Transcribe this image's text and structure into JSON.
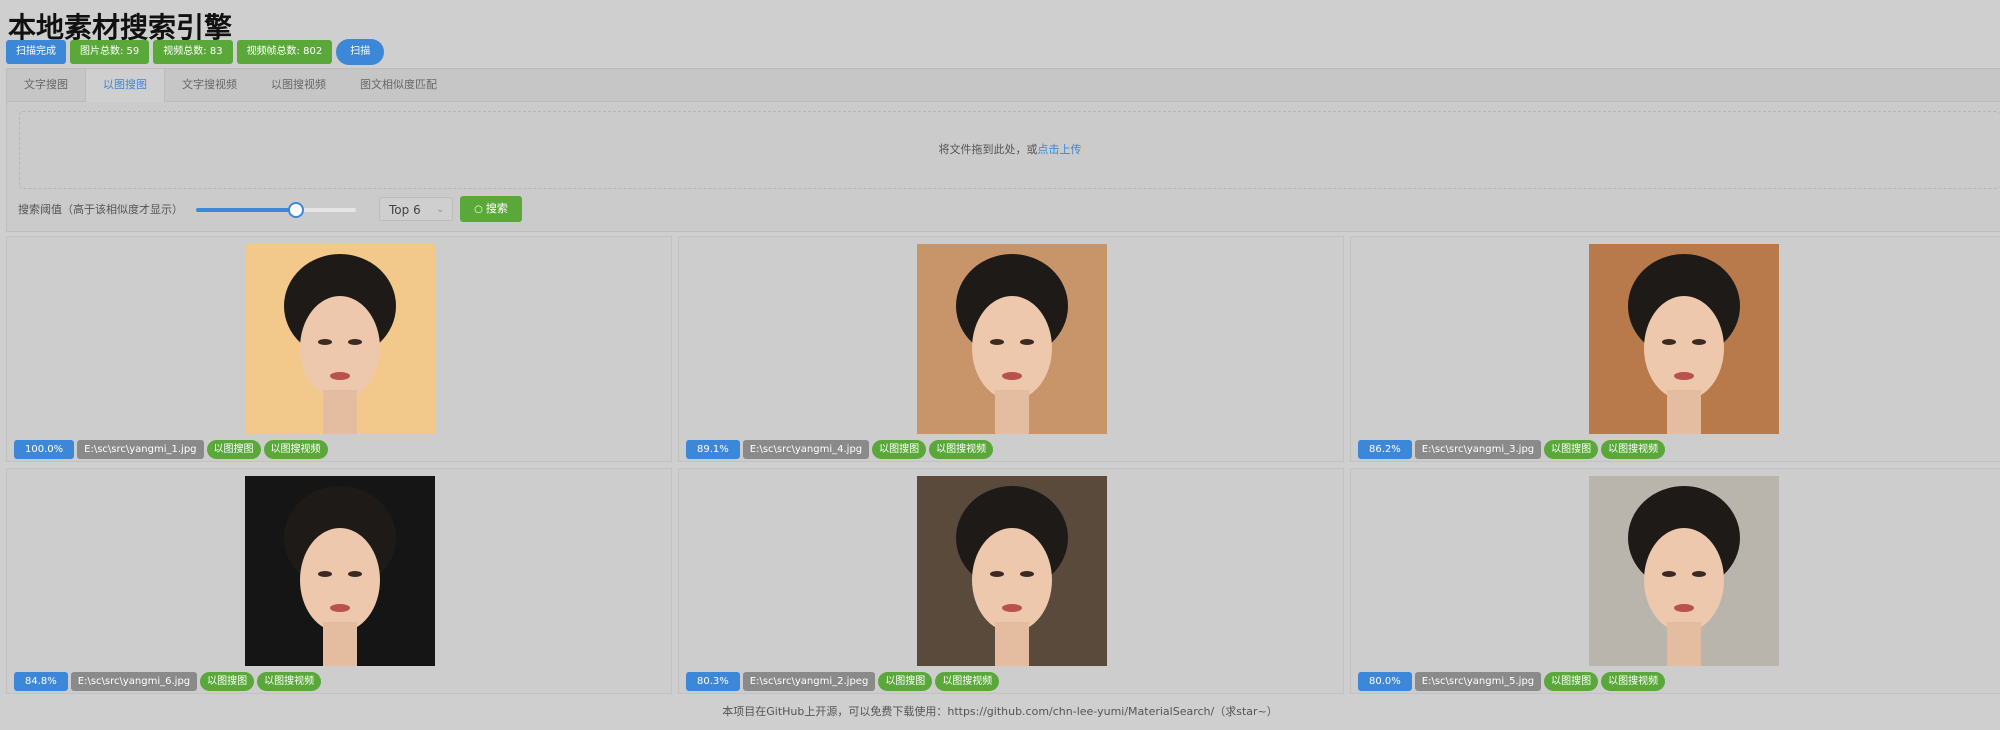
{
  "app": {
    "title": "本地素材搜索引擎"
  },
  "status": {
    "scan_state": "扫描完成",
    "image_total": "图片总数: 59",
    "video_total": "视频总数: 83",
    "frame_total": "视频帧总数: 802",
    "scan_button": "扫描"
  },
  "tabs": [
    {
      "label": "文字搜图",
      "active": false
    },
    {
      "label": "以图搜图",
      "active": true
    },
    {
      "label": "文字搜视频",
      "active": false
    },
    {
      "label": "以图搜视频",
      "active": false
    },
    {
      "label": "图文相似度匹配",
      "active": false
    }
  ],
  "upload": {
    "text": "将文件拖到此处，或",
    "link": "点击上传"
  },
  "controls": {
    "threshold_label": "搜索阈值（高于该相似度才显示）",
    "threshold_value": 0.62,
    "top_k": "Top 6",
    "search_button": "搜索"
  },
  "results": [
    {
      "score": "100.0%",
      "path": "E:\\sc\\src\\yangmi_1.jpg",
      "search_image": "以图搜图",
      "search_video": "以图搜视频",
      "bg": "#f2c98a"
    },
    {
      "score": "89.1%",
      "path": "E:\\sc\\src\\yangmi_4.jpg",
      "search_image": "以图搜图",
      "search_video": "以图搜视频",
      "bg": "#c8946a"
    },
    {
      "score": "86.2%",
      "path": "E:\\sc\\src\\yangmi_3.jpg",
      "search_image": "以图搜图",
      "search_video": "以图搜视频",
      "bg": "#b87a4a"
    },
    {
      "score": "84.8%",
      "path": "E:\\sc\\src\\yangmi_6.jpg",
      "search_image": "以图搜图",
      "search_video": "以图搜视频",
      "bg": "#151515"
    },
    {
      "score": "80.3%",
      "path": "E:\\sc\\src\\yangmi_2.jpeg",
      "search_image": "以图搜图",
      "search_video": "以图搜视频",
      "bg": "#5a4a3c"
    },
    {
      "score": "80.0%",
      "path": "E:\\sc\\src\\yangmi_5.jpg",
      "search_image": "以图搜图",
      "search_video": "以图搜视频",
      "bg": "#b9b4ac"
    }
  ],
  "footer": {
    "text": "本项目在GitHub上开源，可以免费下载使用：https://github.com/chn-lee-yumi/MaterialSearch/（求star~）"
  },
  "colors": {
    "accent": "#3d87d8",
    "success": "#5aa83a",
    "muted": "#8a8a8a"
  }
}
